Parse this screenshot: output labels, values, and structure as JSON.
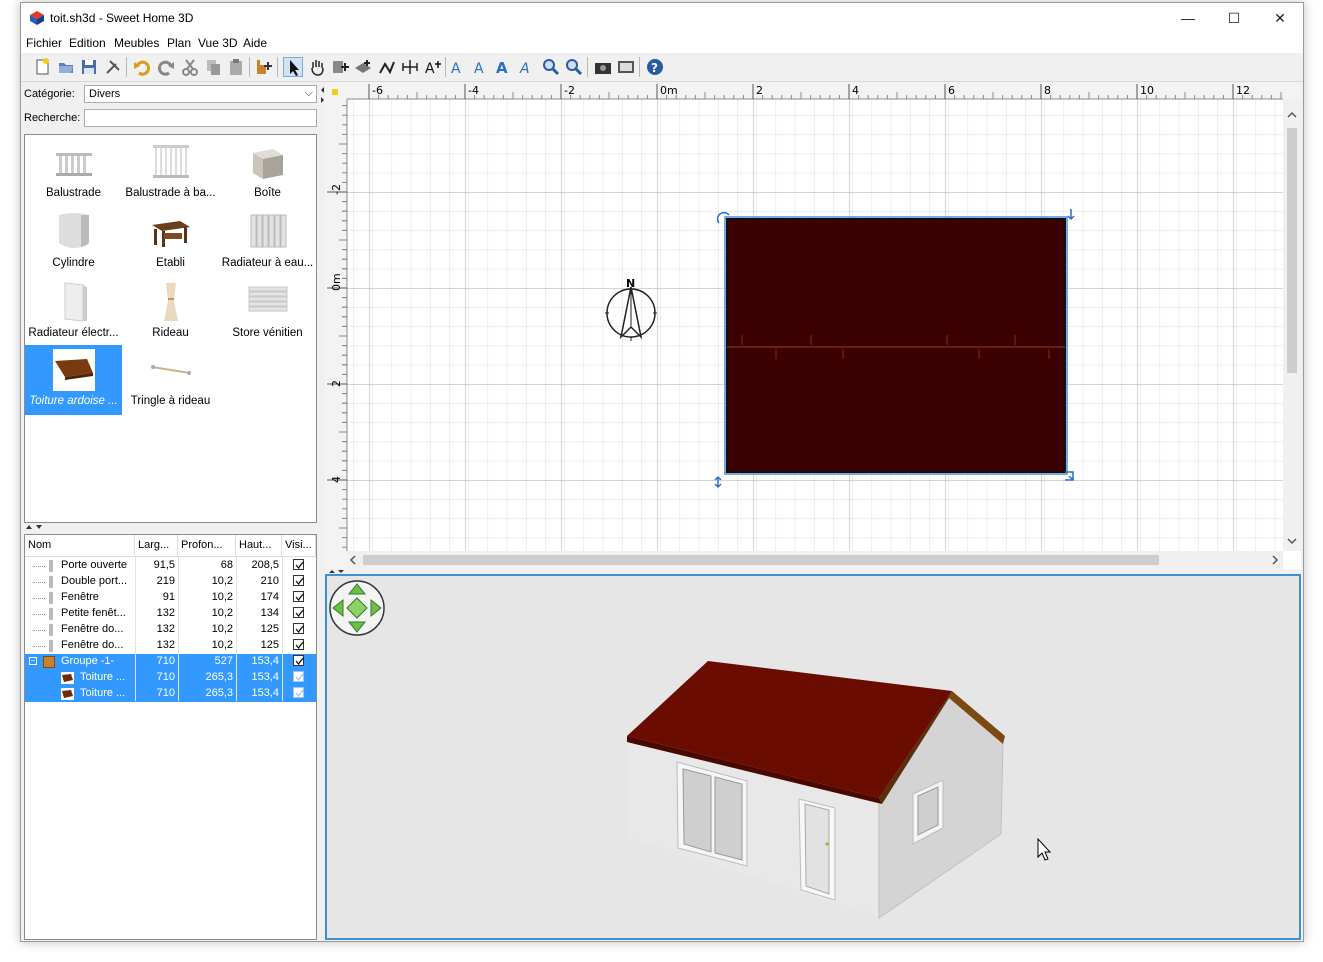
{
  "window": {
    "title": "toit.sh3d - Sweet Home 3D",
    "minimize": "—",
    "maximize": "☐",
    "close": "✕"
  },
  "menu": [
    "Fichier",
    "Edition",
    "Meubles",
    "Plan",
    "Vue 3D",
    "Aide"
  ],
  "toolbar_icons": [
    "new-file-icon",
    "open-icon",
    "save-icon",
    "preferences-icon",
    "undo-icon",
    "redo-icon",
    "cut-icon",
    "copy-icon",
    "paste-icon",
    "add-furniture-icon",
    "select-arrow-icon",
    "pan-hand-icon",
    "create-walls-icon",
    "create-rooms-icon",
    "create-polylines-icon",
    "create-dimensions-icon",
    "add-text-icon",
    "text-style-1-icon",
    "text-style-2-icon",
    "text-style-3-icon",
    "text-style-4-icon",
    "zoom-in-icon",
    "zoom-out-icon",
    "photo-icon",
    "video-icon",
    "help-icon"
  ],
  "catalog": {
    "category_label": "Catégorie:",
    "category_value": "Divers",
    "search_label": "Recherche:",
    "search_value": "",
    "items": [
      {
        "name": "Balustrade",
        "icon": "balustrade-icon"
      },
      {
        "name": "Balustrade à ba...",
        "icon": "balustrade-bars-icon"
      },
      {
        "name": "Boîte",
        "icon": "box-icon"
      },
      {
        "name": "Cylindre",
        "icon": "cylinder-icon"
      },
      {
        "name": "Etabli",
        "icon": "workbench-icon"
      },
      {
        "name": "Radiateur à eau...",
        "icon": "water-radiator-icon"
      },
      {
        "name": "Radiateur électr...",
        "icon": "electric-radiator-icon"
      },
      {
        "name": "Rideau",
        "icon": "curtain-icon"
      },
      {
        "name": "Store vénitien",
        "icon": "venetian-blind-icon"
      },
      {
        "name": "Toiture ardoise ...",
        "icon": "slate-roof-icon",
        "selected": true
      },
      {
        "name": "Tringle à rideau",
        "icon": "curtain-rod-icon"
      }
    ]
  },
  "furniture_table": {
    "headers": [
      "Nom",
      "Larg...",
      "Profon...",
      "Haut...",
      "Visi..."
    ],
    "rows": [
      {
        "name": "Porte ouverte",
        "w": "91,5",
        "d": "68",
        "h": "208,5",
        "visible": true,
        "level": 1,
        "selected": false
      },
      {
        "name": "Double port...",
        "w": "219",
        "d": "10,2",
        "h": "210",
        "visible": true,
        "level": 1,
        "selected": false
      },
      {
        "name": "Fenêtre",
        "w": "91",
        "d": "10,2",
        "h": "174",
        "visible": true,
        "level": 1,
        "selected": false
      },
      {
        "name": "Petite fenêt...",
        "w": "132",
        "d": "10,2",
        "h": "134",
        "visible": true,
        "level": 1,
        "selected": false
      },
      {
        "name": "Fenêtre do...",
        "w": "132",
        "d": "10,2",
        "h": "125",
        "visible": true,
        "level": 1,
        "selected": false
      },
      {
        "name": "Fenêtre do...",
        "w": "132",
        "d": "10,2",
        "h": "125",
        "visible": true,
        "level": 1,
        "selected": false
      },
      {
        "name": "Groupe -1-",
        "w": "710",
        "d": "527",
        "h": "153,4",
        "visible": true,
        "level": 0,
        "selected": true,
        "group": true
      },
      {
        "name": "Toiture ...",
        "w": "710",
        "d": "265,3",
        "h": "153,4",
        "visible": true,
        "level": 2,
        "selected": true
      },
      {
        "name": "Toiture ...",
        "w": "710",
        "d": "265,3",
        "h": "153,4",
        "visible": true,
        "level": 2,
        "selected": true
      }
    ]
  },
  "plan": {
    "x_ticks": [
      "-6",
      "-4",
      "-2",
      "0m",
      "2",
      "4",
      "6",
      "8",
      "10",
      "12"
    ],
    "y_ticks": [
      "-2",
      "0m",
      "2",
      "4"
    ],
    "compass_label": "N",
    "roof_color": "#3b0000"
  },
  "view3d": {
    "roof_color": "#6b0c00",
    "wall_color": "#e8e8e8"
  },
  "colors": {
    "selection": "#3399ff",
    "focus_border": "#3d8fd6"
  }
}
